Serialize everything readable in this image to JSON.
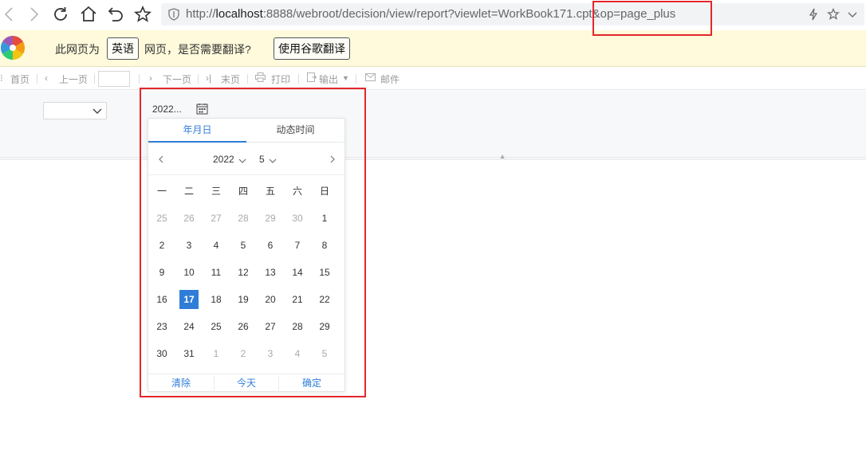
{
  "browser": {
    "url_prefix": "http://",
    "url_host": "localhost",
    "url_rest": ":8888/webroot/decision/view/report?viewlet=WorkBook171.cpt&op=page_plus"
  },
  "translate_bar": {
    "text_before": "此网页为",
    "language_button": "英语",
    "text_after": "网页，是否需要翻译?",
    "translate_button": "使用谷歌翻译"
  },
  "report_toolbar": {
    "first_page": "首页",
    "prev_page": "上一页",
    "next_page": "下一页",
    "last_page": "末页",
    "print": "打印",
    "export": "输出",
    "mail": "邮件"
  },
  "date_field": {
    "value": "2022..."
  },
  "calendar": {
    "tabs": [
      "年月日",
      "动态时间"
    ],
    "year": "2022",
    "month": "5",
    "weekdays": [
      "一",
      "二",
      "三",
      "四",
      "五",
      "六",
      "日"
    ],
    "days": [
      {
        "d": "25",
        "other": true
      },
      {
        "d": "26",
        "other": true
      },
      {
        "d": "27",
        "other": true
      },
      {
        "d": "28",
        "other": true
      },
      {
        "d": "29",
        "other": true
      },
      {
        "d": "30",
        "other": true
      },
      {
        "d": "1"
      },
      {
        "d": "2"
      },
      {
        "d": "3"
      },
      {
        "d": "4"
      },
      {
        "d": "5"
      },
      {
        "d": "6"
      },
      {
        "d": "7"
      },
      {
        "d": "8"
      },
      {
        "d": "9"
      },
      {
        "d": "10"
      },
      {
        "d": "11"
      },
      {
        "d": "12"
      },
      {
        "d": "13"
      },
      {
        "d": "14"
      },
      {
        "d": "15"
      },
      {
        "d": "16"
      },
      {
        "d": "17",
        "selected": true
      },
      {
        "d": "18"
      },
      {
        "d": "19"
      },
      {
        "d": "20"
      },
      {
        "d": "21"
      },
      {
        "d": "22"
      },
      {
        "d": "23"
      },
      {
        "d": "24"
      },
      {
        "d": "25"
      },
      {
        "d": "26"
      },
      {
        "d": "27"
      },
      {
        "d": "28"
      },
      {
        "d": "29"
      },
      {
        "d": "30"
      },
      {
        "d": "31"
      },
      {
        "d": "1",
        "other": true
      },
      {
        "d": "2",
        "other": true
      },
      {
        "d": "3",
        "other": true
      },
      {
        "d": "4",
        "other": true
      },
      {
        "d": "5",
        "other": true
      }
    ],
    "footer": {
      "clear": "清除",
      "today": "今天",
      "confirm": "确定"
    }
  },
  "colors": {
    "accent": "#2f7dd9",
    "highlight_box": "#e3262b",
    "translate_bar_bg": "#fefadb"
  }
}
